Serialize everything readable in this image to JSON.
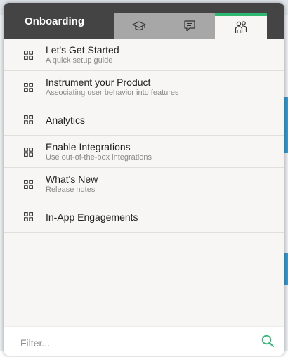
{
  "panel": {
    "title": "Onboarding",
    "tabs": [
      {
        "icon": "graduation-cap-icon",
        "active": false
      },
      {
        "icon": "chat-bubble-icon",
        "active": false
      },
      {
        "icon": "people-icon",
        "active": true
      }
    ]
  },
  "items": [
    {
      "label": "Let's Get Started",
      "sub": "A quick setup guide",
      "icon": "grid-icon"
    },
    {
      "label": "Instrument your Product",
      "sub": "Associating user behavior into features",
      "icon": "grid-icon"
    },
    {
      "label": "Analytics",
      "sub": "",
      "icon": "grid-icon"
    },
    {
      "label": "Enable Integrations",
      "sub": "Use out-of-the-box integrations",
      "icon": "grid-icon"
    },
    {
      "label": "What's New",
      "sub": "Release notes",
      "icon": "grid-icon"
    },
    {
      "label": "In-App Engagements",
      "sub": "",
      "icon": "grid-icon"
    }
  ],
  "filter": {
    "placeholder": "Filter...",
    "value": ""
  },
  "colors": {
    "header_bg": "#444444",
    "tab_inactive": "#a7a7a7",
    "tab_active_border": "#2eb872",
    "search_icon": "#2eb872"
  }
}
